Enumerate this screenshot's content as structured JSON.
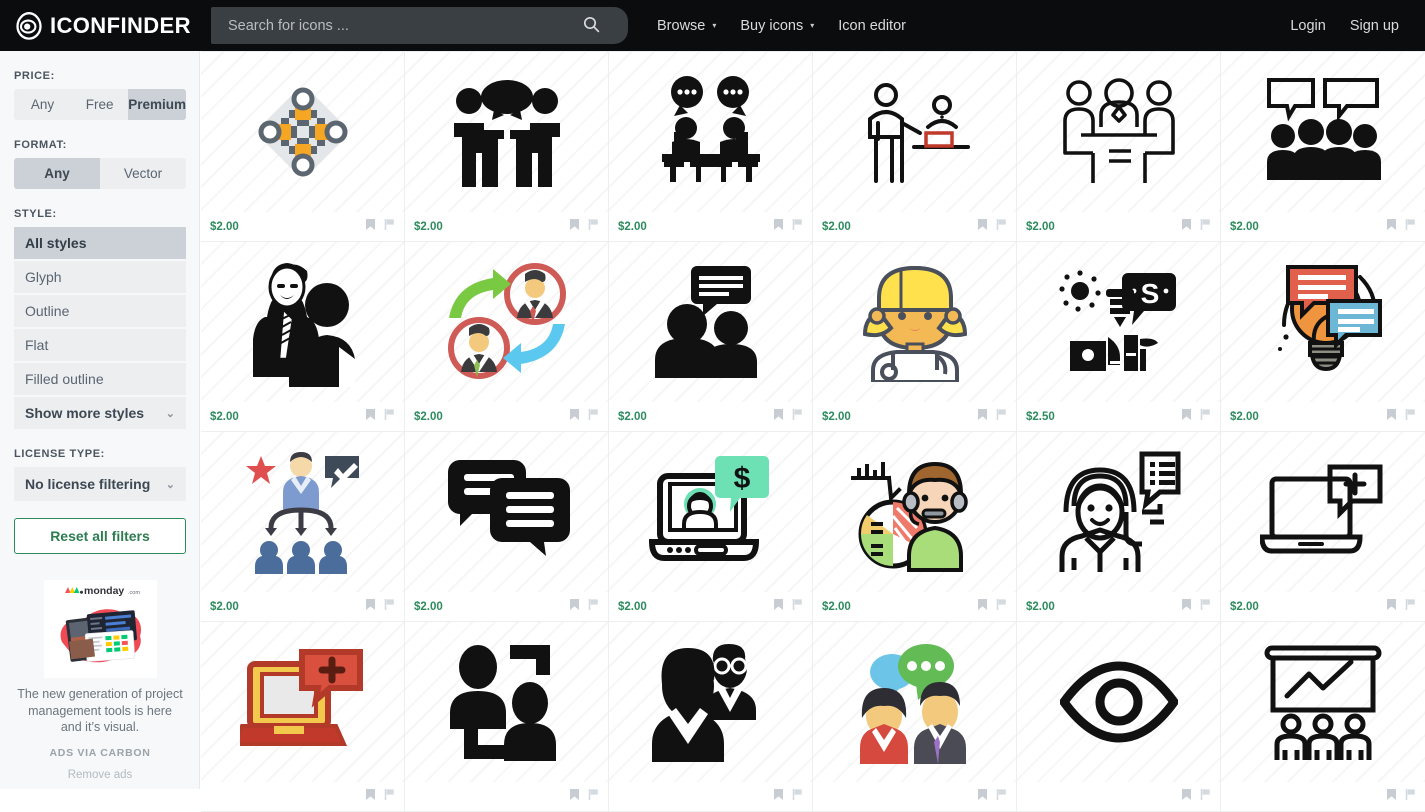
{
  "header": {
    "logo_text": "ICONFINDER",
    "logo_icon": "iconfinder-egg-eye-logo",
    "search": {
      "placeholder": "Search for icons ...",
      "value": "",
      "icon": "search-icon"
    },
    "nav": [
      {
        "label": "Browse",
        "has_caret": true,
        "caret": "▾"
      },
      {
        "label": "Buy icons",
        "has_caret": true,
        "caret": "▾"
      },
      {
        "label": "Icon editor",
        "has_caret": false,
        "caret": ""
      }
    ],
    "account": [
      {
        "label": "Login"
      },
      {
        "label": "Sign up"
      }
    ]
  },
  "sidebar": {
    "price": {
      "label": "PRICE:",
      "options": [
        {
          "label": "Any",
          "active": false
        },
        {
          "label": "Free",
          "active": false
        },
        {
          "label": "Premium",
          "active": true
        }
      ]
    },
    "format": {
      "label": "FORMAT:",
      "options": [
        {
          "label": "Any",
          "active": true
        },
        {
          "label": "Vector",
          "active": false
        }
      ]
    },
    "style": {
      "label": "STYLE:",
      "options": [
        {
          "label": "All styles",
          "active": true
        },
        {
          "label": "Glyph",
          "active": false
        },
        {
          "label": "Outline",
          "active": false
        },
        {
          "label": "Flat",
          "active": false
        },
        {
          "label": "Filled outline",
          "active": false
        }
      ],
      "more_label": "Show more styles",
      "more_chevron": "⌄"
    },
    "license": {
      "label": "LICENSE TYPE:",
      "selected": "No license filtering",
      "chevron": "⌄"
    },
    "reset_label": "Reset all filters",
    "ad": {
      "brand": "monday",
      "brand_suffix": ".com",
      "text": "The new generation of project management tools is here and it’s visual.",
      "carbon_label": "ADS VIA CARBON",
      "remove_label": "Remove ads"
    }
  },
  "grid": {
    "meta_icons": {
      "bookmark": "bookmark-icon",
      "flag": "flag-icon"
    },
    "rows": [
      {
        "cells": [
          {
            "price": "$2.00",
            "icon": "round-table-meeting-flat-icon"
          },
          {
            "price": "$2.00",
            "icon": "two-people-talking-glyph-icon"
          },
          {
            "price": "$2.00",
            "icon": "meeting-table-speech-bubbles-icon"
          },
          {
            "price": "$2.00",
            "icon": "presenter-and-desk-outline-icon"
          },
          {
            "price": "$2.00",
            "icon": "three-people-table-outline-icon"
          },
          {
            "price": "$2.00",
            "icon": "crowd-speech-bubbles-glyph-icon"
          }
        ]
      },
      {
        "cells": [
          {
            "price": "$2.00",
            "icon": "business-duo-portrait-glyph-icon"
          },
          {
            "price": "$2.00",
            "icon": "user-exchange-arrows-icon"
          },
          {
            "price": "$2.00",
            "icon": "group-chat-glyph-icon"
          },
          {
            "price": "$2.00",
            "icon": "blonde-support-agent-flat-icon"
          },
          {
            "price": "$2.50",
            "icon": "presenter-money-bubble-glyph-icon"
          },
          {
            "price": "$2.00",
            "icon": "lightbulb-idea-chat-icon"
          }
        ]
      },
      {
        "cells": [
          {
            "price": "$2.00",
            "icon": "org-delegation-flat-icon"
          },
          {
            "price": "$2.00",
            "icon": "two-speech-bubbles-glyph-icon"
          },
          {
            "price": "$2.00",
            "icon": "laptop-video-call-money-icon"
          },
          {
            "price": "$2.00",
            "icon": "agent-pie-chart-flat-icon"
          },
          {
            "price": "$2.00",
            "icon": "headset-agent-outline-icon"
          },
          {
            "price": "$2.00",
            "icon": "laptop-add-user-outline-icon"
          }
        ]
      },
      {
        "cells": [
          {
            "price": "",
            "icon": "laptop-chat-plus-flat-icon"
          },
          {
            "price": "",
            "icon": "video-conference-glyph-icon"
          },
          {
            "price": "",
            "icon": "two-businessmen-glyph-icon"
          },
          {
            "price": "",
            "icon": "couple-chat-bubbles-flat-icon"
          },
          {
            "price": "",
            "icon": "eye-outline-icon"
          },
          {
            "price": "",
            "icon": "presentation-audience-outline-icon"
          }
        ]
      }
    ]
  },
  "colors": {
    "header_bg": "#0b0c0d",
    "search_bg": "#3a3f44",
    "sidebar_bg": "#f7f8f9",
    "price_green": "#2e8b5e",
    "reset_green": "#2e7d52",
    "accent_orange": "#f5a623",
    "accent_red": "#c0392b",
    "accent_blue": "#6f8fc4"
  }
}
